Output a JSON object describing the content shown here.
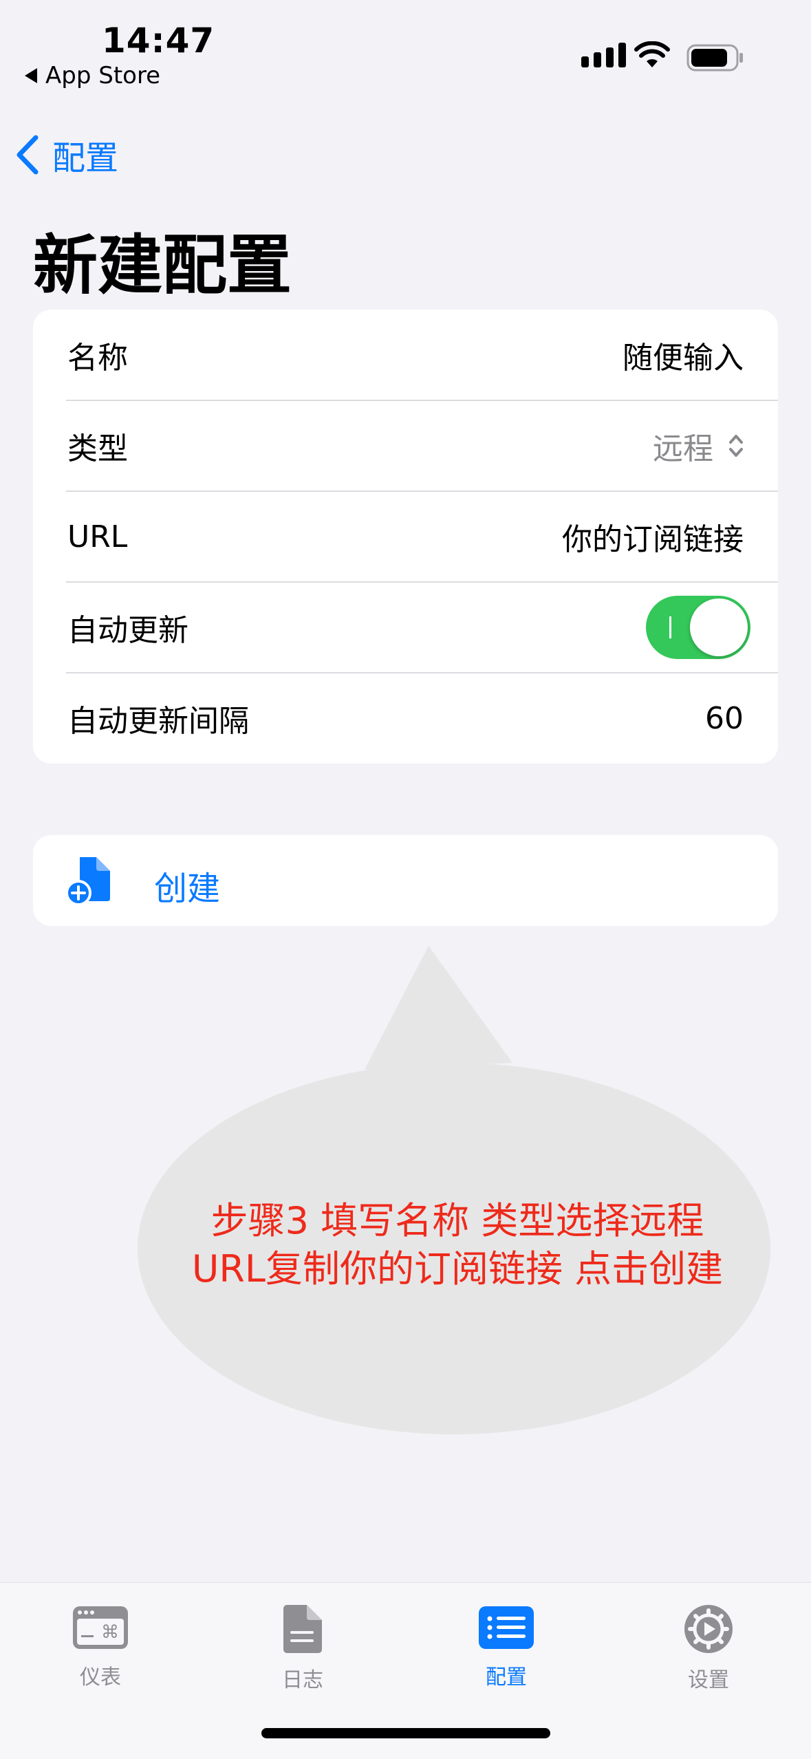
{
  "status_bar": {
    "time": "14:47",
    "back_app": "App Store"
  },
  "nav": {
    "back_label": "配置",
    "title": "新建配置"
  },
  "form": {
    "rows": [
      {
        "label": "名称",
        "value": "随便输入"
      },
      {
        "label": "类型",
        "value": "远程"
      },
      {
        "label": "URL",
        "value": "你的订阅链接"
      },
      {
        "label": "自动更新",
        "toggle_on": true
      },
      {
        "label": "自动更新间隔",
        "value": "60"
      }
    ]
  },
  "create": {
    "label": "创建"
  },
  "annotation": {
    "line1": "步骤3 填写名称 类型选择远程",
    "line2": "URL复制你的订阅链接 点击创建"
  },
  "tabbar": {
    "tabs": [
      {
        "label": "仪表",
        "icon": "dashboard-icon"
      },
      {
        "label": "日志",
        "icon": "log-document-icon"
      },
      {
        "label": "配置",
        "icon": "config-list-icon",
        "active": true
      },
      {
        "label": "设置",
        "icon": "settings-gear-icon"
      }
    ]
  },
  "colors": {
    "accent": "#0a7aff",
    "toggle_on": "#34c759",
    "annotation_text": "#ee2a1b",
    "background": "#f2f2f7"
  }
}
